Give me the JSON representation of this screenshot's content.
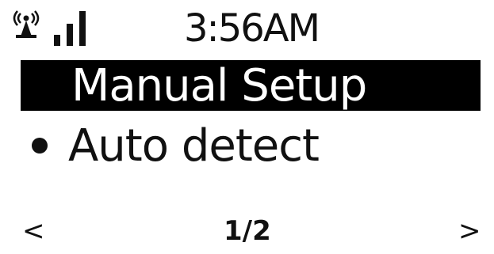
{
  "status_bar": {
    "time": "3:56AM",
    "wifi_icon": "wifi-antenna-icon",
    "signal_icon": "signal-strength-bars-icon",
    "signal_level": 3
  },
  "menu": {
    "items": [
      {
        "label": "Manual Setup",
        "selected": true
      },
      {
        "label": "Auto detect",
        "selected": false,
        "marker": "bullet"
      }
    ]
  },
  "footer": {
    "prev": "<",
    "page": "1/2",
    "next": ">"
  },
  "colors": {
    "background": "#ffffff",
    "text": "#111111",
    "highlight_bg": "#000000",
    "highlight_text": "#ffffff"
  }
}
